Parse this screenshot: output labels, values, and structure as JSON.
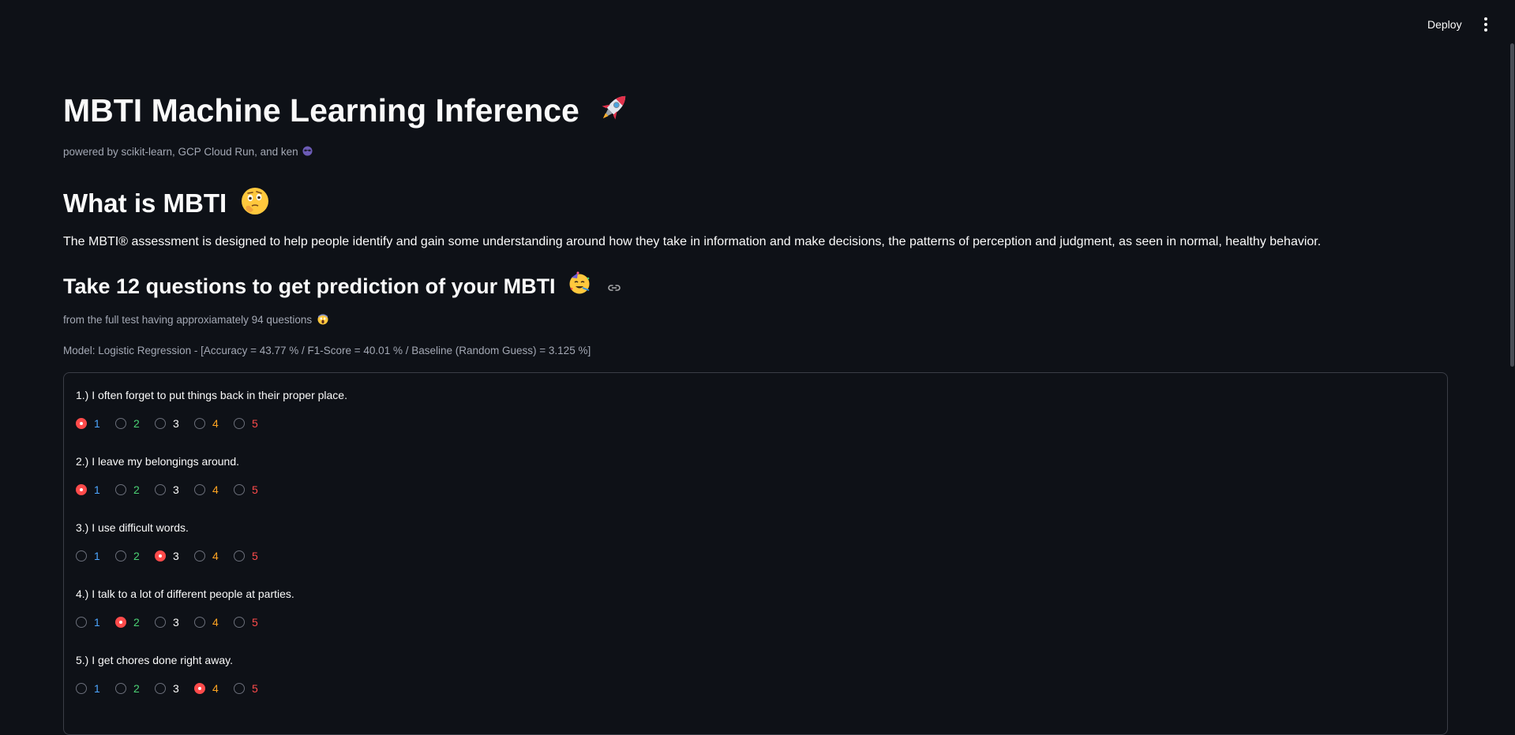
{
  "header": {
    "deploy_label": "Deploy"
  },
  "page": {
    "title": "MBTI Machine Learning Inference",
    "title_icon": "rocket-icon",
    "subtitle": "powered by scikit-learn, GCP Cloud Run, and ken",
    "subtitle_icon": "sunglasses-face-icon",
    "section_title": "What is MBTI",
    "section_icon": "thinking-face-icon",
    "description": "The MBTI® assessment is designed to help people identify and gain some understanding around how they take in information and make decisions, the patterns of perception and judgment, as seen in normal, healthy behavior.",
    "test_title": "Take 12 questions to get prediction of your MBTI",
    "test_icon": "party-face-icon",
    "test_caption": "from the full test having approxiamately 94 questions",
    "test_caption_icon": "scream-face-icon",
    "model_caption": "Model: Logistic Regression - [Accuracy = 43.77 % / F1-Score = 40.01 % / Baseline (Random Guess) = 3.125 %]"
  },
  "options": {
    "labels": [
      "1",
      "2",
      "3",
      "4",
      "5"
    ],
    "colors": [
      "#4da6ff",
      "#4bd174",
      "#fafafa",
      "#ffa421",
      "#ff4b4b"
    ]
  },
  "questions": [
    {
      "label": "1.) I often forget to put things back in their proper place.",
      "selected": 1
    },
    {
      "label": "2.) I leave my belongings around.",
      "selected": 1
    },
    {
      "label": "3.) I use difficult words.",
      "selected": 3
    },
    {
      "label": "4.) I talk to a lot of different people at parties.",
      "selected": 2
    },
    {
      "label": "5.) I get chores done right away.",
      "selected": 4
    }
  ],
  "colors": {
    "background": "#0e1117",
    "accent": "#ff4b4b",
    "text": "#fafafa",
    "muted": "#a3a8b4"
  }
}
